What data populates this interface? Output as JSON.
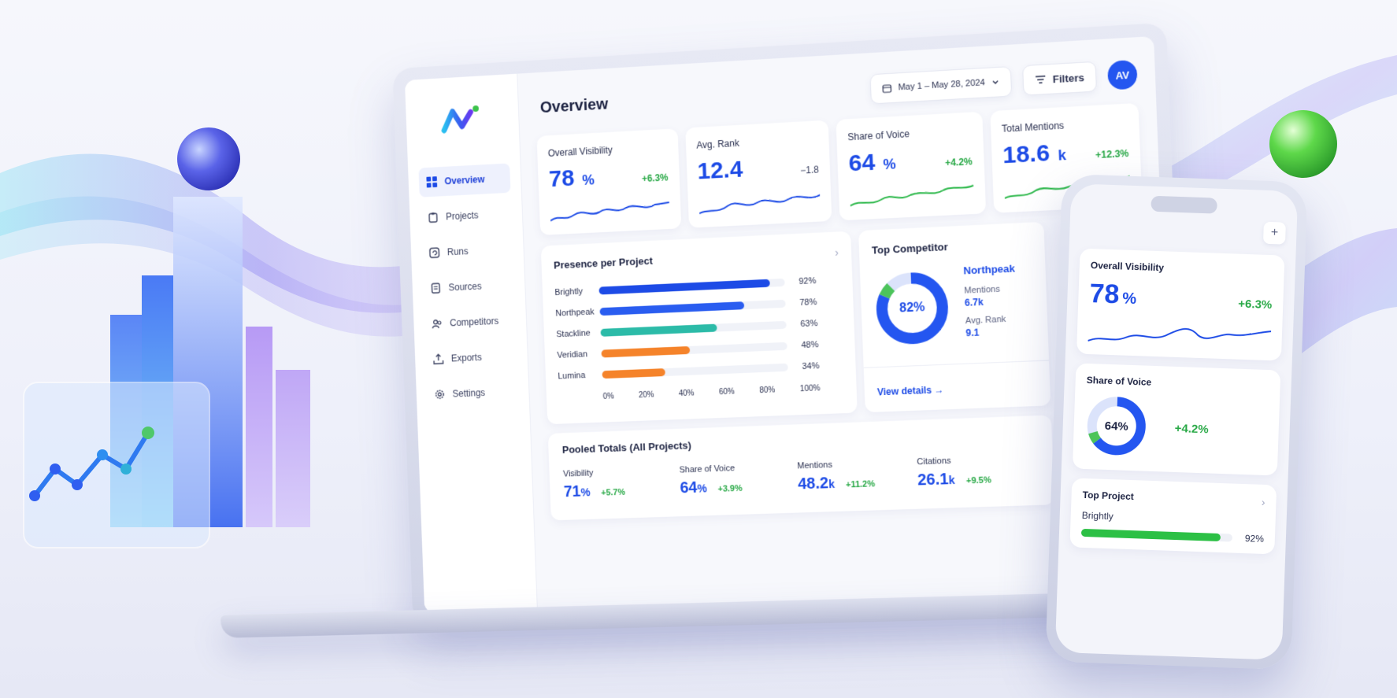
{
  "colors": {
    "accent": "#1d4be6",
    "positive": "#27a845",
    "bar_blue": "#1d4be6",
    "bar_teal": "#2cbba8",
    "bar_orange": "#f5832a",
    "bar_green": "#2cc045"
  },
  "sidebar": {
    "items": [
      {
        "label": "Overview",
        "icon": "grid-icon"
      },
      {
        "label": "Projects",
        "icon": "clipboard-icon"
      },
      {
        "label": "Runs",
        "icon": "refresh-icon"
      },
      {
        "label": "Sources",
        "icon": "document-icon"
      },
      {
        "label": "Competitors",
        "icon": "users-icon"
      },
      {
        "label": "Exports",
        "icon": "upload-icon"
      },
      {
        "label": "Settings",
        "icon": "gear-icon"
      }
    ]
  },
  "header": {
    "title": "Overview",
    "date_range": "May 1 – May 28, 2024",
    "filters_label": "Filters",
    "avatar_initials": "AV"
  },
  "kpis": [
    {
      "label": "Overall Visibility",
      "value": "78",
      "unit": "%",
      "delta": "+6.3%"
    },
    {
      "label": "Avg. Rank",
      "value": "12.4",
      "unit": "",
      "delta": "−1.8"
    },
    {
      "label": "Share of Voice",
      "value": "64",
      "unit": "%",
      "delta": "+4.2%"
    },
    {
      "label": "Total Mentions",
      "value": "18.6",
      "unit": "k",
      "delta": "+12.3%"
    }
  ],
  "presence": {
    "title": "Presence per Project",
    "rows": [
      {
        "label": "Brightly",
        "value": 92,
        "display": "92%",
        "color": "#1d4be6"
      },
      {
        "label": "Northpeak",
        "value": 78,
        "display": "78%",
        "color": "#2a5df0"
      },
      {
        "label": "Stackline",
        "value": 63,
        "display": "63%",
        "color": "#2cbba8"
      },
      {
        "label": "Veridian",
        "value": 48,
        "display": "48%",
        "color": "#f5832a"
      },
      {
        "label": "Lumina",
        "value": 34,
        "display": "34%",
        "color": "#f5832a"
      }
    ],
    "axis": [
      "0%",
      "20%",
      "40%",
      "60%",
      "80%",
      "100%"
    ]
  },
  "competitor": {
    "title": "Top Competitor",
    "share": 82,
    "share_label": "82%",
    "name": "Northpeak",
    "mentions_label": "Mentions",
    "mentions_value": "6.7k",
    "rank_label": "Avg. Rank",
    "rank_value": "9.1",
    "link": "View details"
  },
  "pooled": {
    "title": "Pooled Totals (All Projects)",
    "items": [
      {
        "label": "Visibility",
        "value": "71",
        "unit": "%",
        "delta": "+5.7%"
      },
      {
        "label": "Share of Voice",
        "value": "64",
        "unit": "%",
        "delta": "+3.9%"
      },
      {
        "label": "Mentions",
        "value": "48.2",
        "unit": "k",
        "delta": "+11.2%"
      },
      {
        "label": "Citations",
        "value": "26.1",
        "unit": "k",
        "delta": "+9.5%"
      }
    ]
  },
  "phone": {
    "visibility": {
      "label": "Overall Visibility",
      "value": "78",
      "unit": "%",
      "delta": "+6.3%"
    },
    "sov": {
      "label": "Share of Voice",
      "share": 64,
      "share_label": "64%",
      "delta": "+4.2%"
    },
    "top_project": {
      "title": "Top Project",
      "name": "Brightly",
      "value": 92,
      "display": "92%"
    }
  }
}
